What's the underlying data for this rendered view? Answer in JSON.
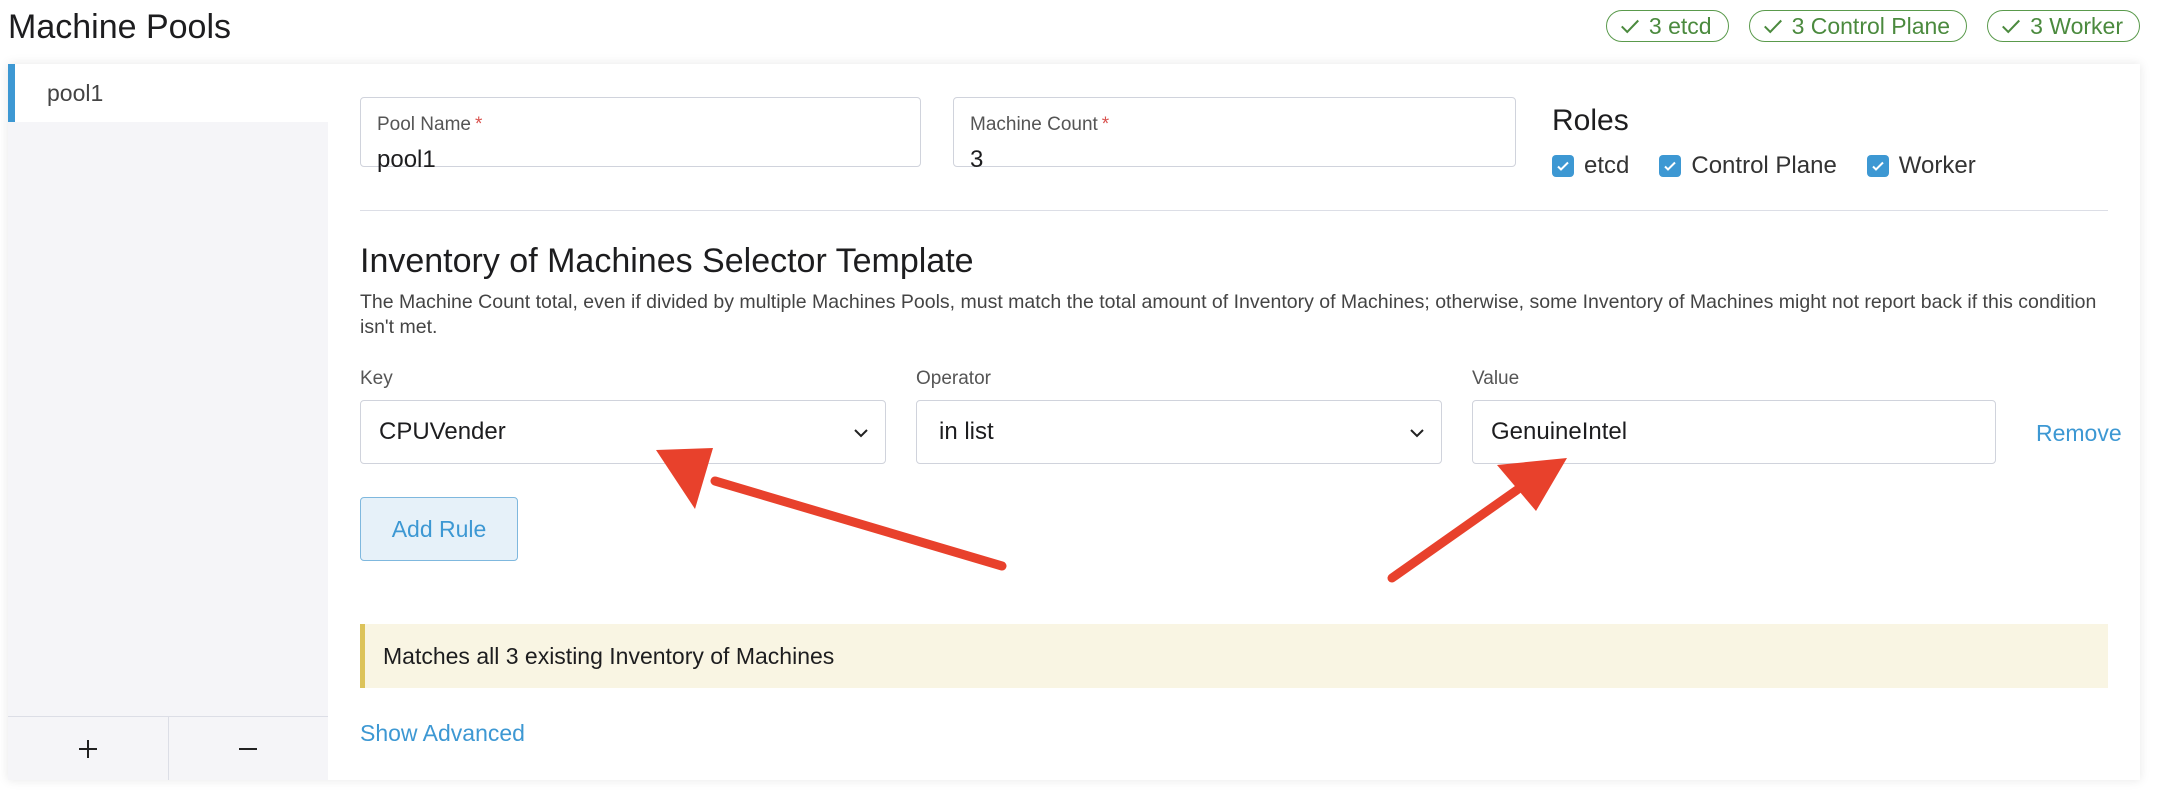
{
  "header": {
    "title": "Machine Pools",
    "badges": [
      "3 etcd",
      "3 Control Plane",
      "3 Worker"
    ]
  },
  "sidebar": {
    "items": [
      {
        "label": "pool1"
      }
    ],
    "add_icon": "plus-icon",
    "remove_icon": "minus-icon"
  },
  "form": {
    "pool_name": {
      "label": "Pool Name",
      "required": "*",
      "value": "pool1"
    },
    "machine_count": {
      "label": "Machine Count",
      "required": "*",
      "value": "3"
    },
    "roles": {
      "title": "Roles",
      "options": [
        {
          "label": "etcd",
          "checked": true
        },
        {
          "label": "Control Plane",
          "checked": true
        },
        {
          "label": "Worker",
          "checked": true
        }
      ]
    }
  },
  "selector": {
    "title": "Inventory of Machines Selector Template",
    "description": "The Machine Count total, even if divided by multiple Machines Pools, must match the total amount of Inventory of Machines; otherwise, some Inventory of Machines might not report back if this condition isn't met.",
    "key_label": "Key",
    "operator_label": "Operator",
    "value_label": "Value",
    "rule": {
      "key": "CPUVender",
      "operator": "in list",
      "value": "GenuineIntel"
    },
    "remove_label": "Remove",
    "add_rule_label": "Add Rule",
    "match_message": "Matches all 3 existing Inventory of Machines",
    "show_advanced_label": "Show Advanced"
  },
  "colors": {
    "accent": "#3d98d3",
    "success": "#4b8a3e",
    "banner_bg": "#f9f5e3",
    "annotation_arrow": "#e8412c"
  }
}
